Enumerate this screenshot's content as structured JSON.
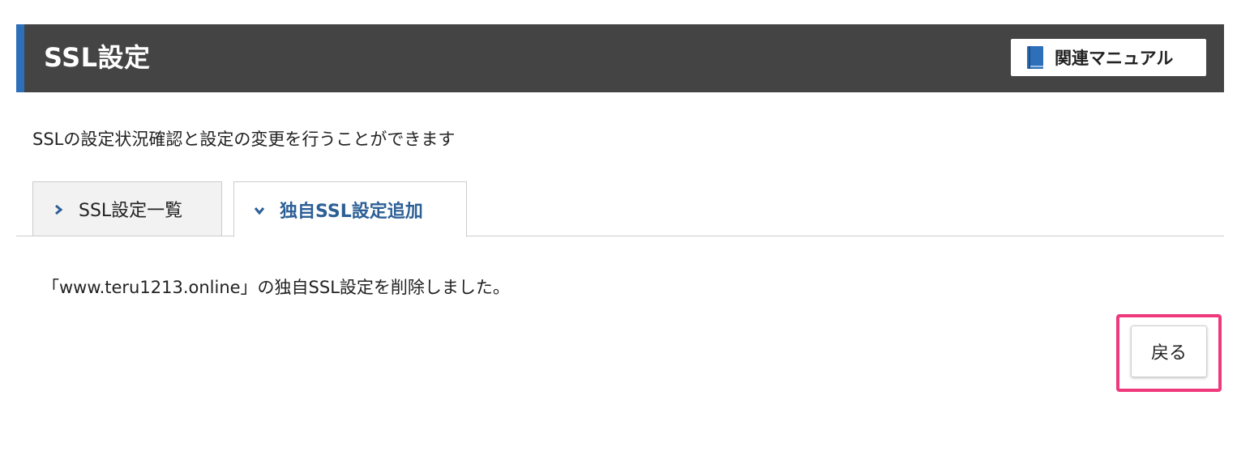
{
  "header": {
    "title": "SSL設定",
    "manual_button_label": "関連マニュアル",
    "manual_icon": "book-icon"
  },
  "description": "SSLの設定状況確認と設定の変更を行うことができます",
  "tabs": [
    {
      "label": "SSL設定一覧",
      "icon": "chevron-right-icon",
      "active": false
    },
    {
      "label": "独自SSL設定追加",
      "icon": "chevron-down-icon",
      "active": true
    }
  ],
  "message": "「www.teru1213.online」の独自SSL設定を削除しました。",
  "back_button_label": "戻る",
  "colors": {
    "header_bg": "#444444",
    "header_accent": "#2d6fb8",
    "active_tab_text": "#2c5f96",
    "highlight": "#ee3a7c"
  }
}
